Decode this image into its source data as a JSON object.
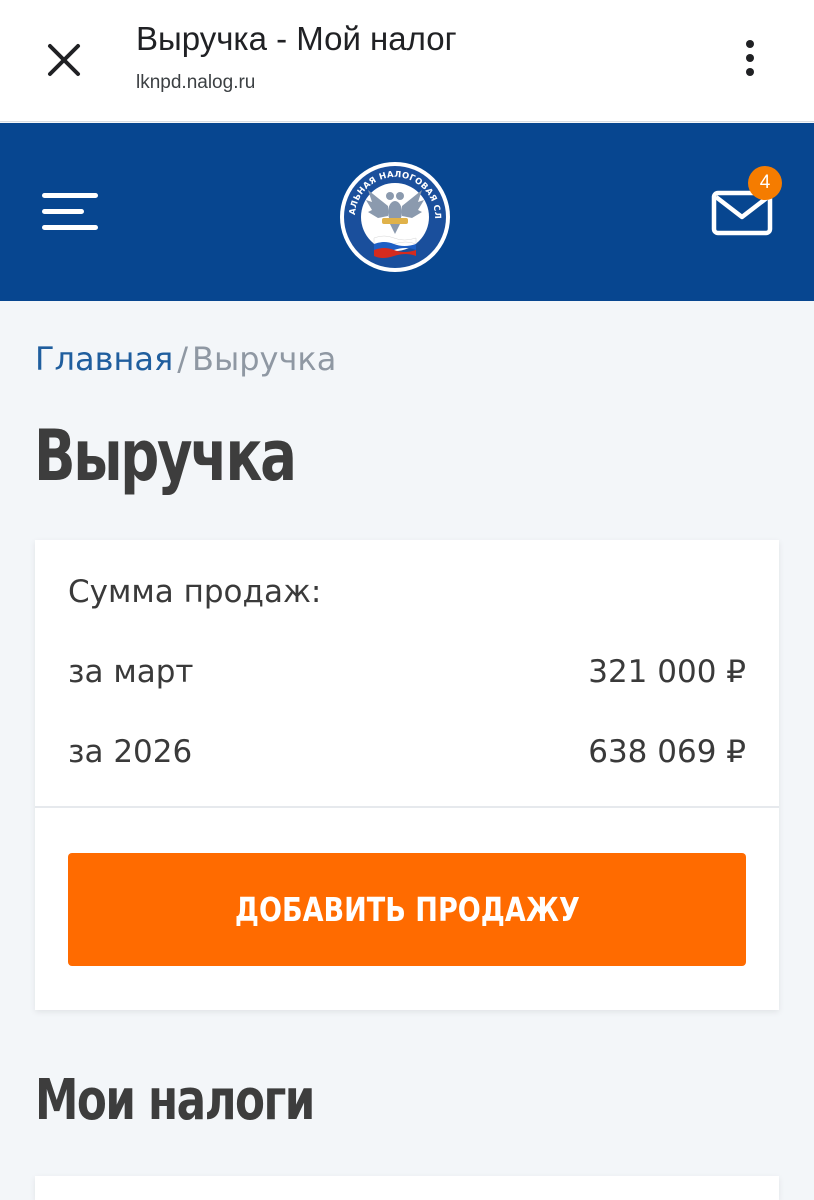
{
  "browser": {
    "title": "Выручка - Мой налог",
    "url": "lknpd.nalog.ru",
    "close_icon": "close-icon",
    "menu_icon": "more-vertical-icon"
  },
  "header": {
    "menu_icon": "hamburger-menu-icon",
    "logo_icon": "fns-emblem-icon",
    "logo_text": "ФЕДЕРАЛЬНАЯ НАЛОГОВАЯ СЛУЖБА",
    "mail_icon": "envelope-icon",
    "notification_count": "4",
    "colors": {
      "header_bg": "#074690",
      "badge": "#f57c00"
    }
  },
  "breadcrumb": {
    "home": "Главная",
    "separator": "/",
    "current": "Выручка"
  },
  "page": {
    "title": "Выручка"
  },
  "sales": {
    "label": "Сумма продаж:",
    "rows": [
      {
        "period": "за март",
        "amount": "321 000 ₽"
      },
      {
        "period": "за 2026",
        "amount": "638 069 ₽"
      }
    ],
    "add_button": "ДОБАВИТЬ ПРОДАЖУ",
    "colors": {
      "button": "#ff6b00"
    }
  },
  "taxes": {
    "title": "Мои налоги"
  }
}
